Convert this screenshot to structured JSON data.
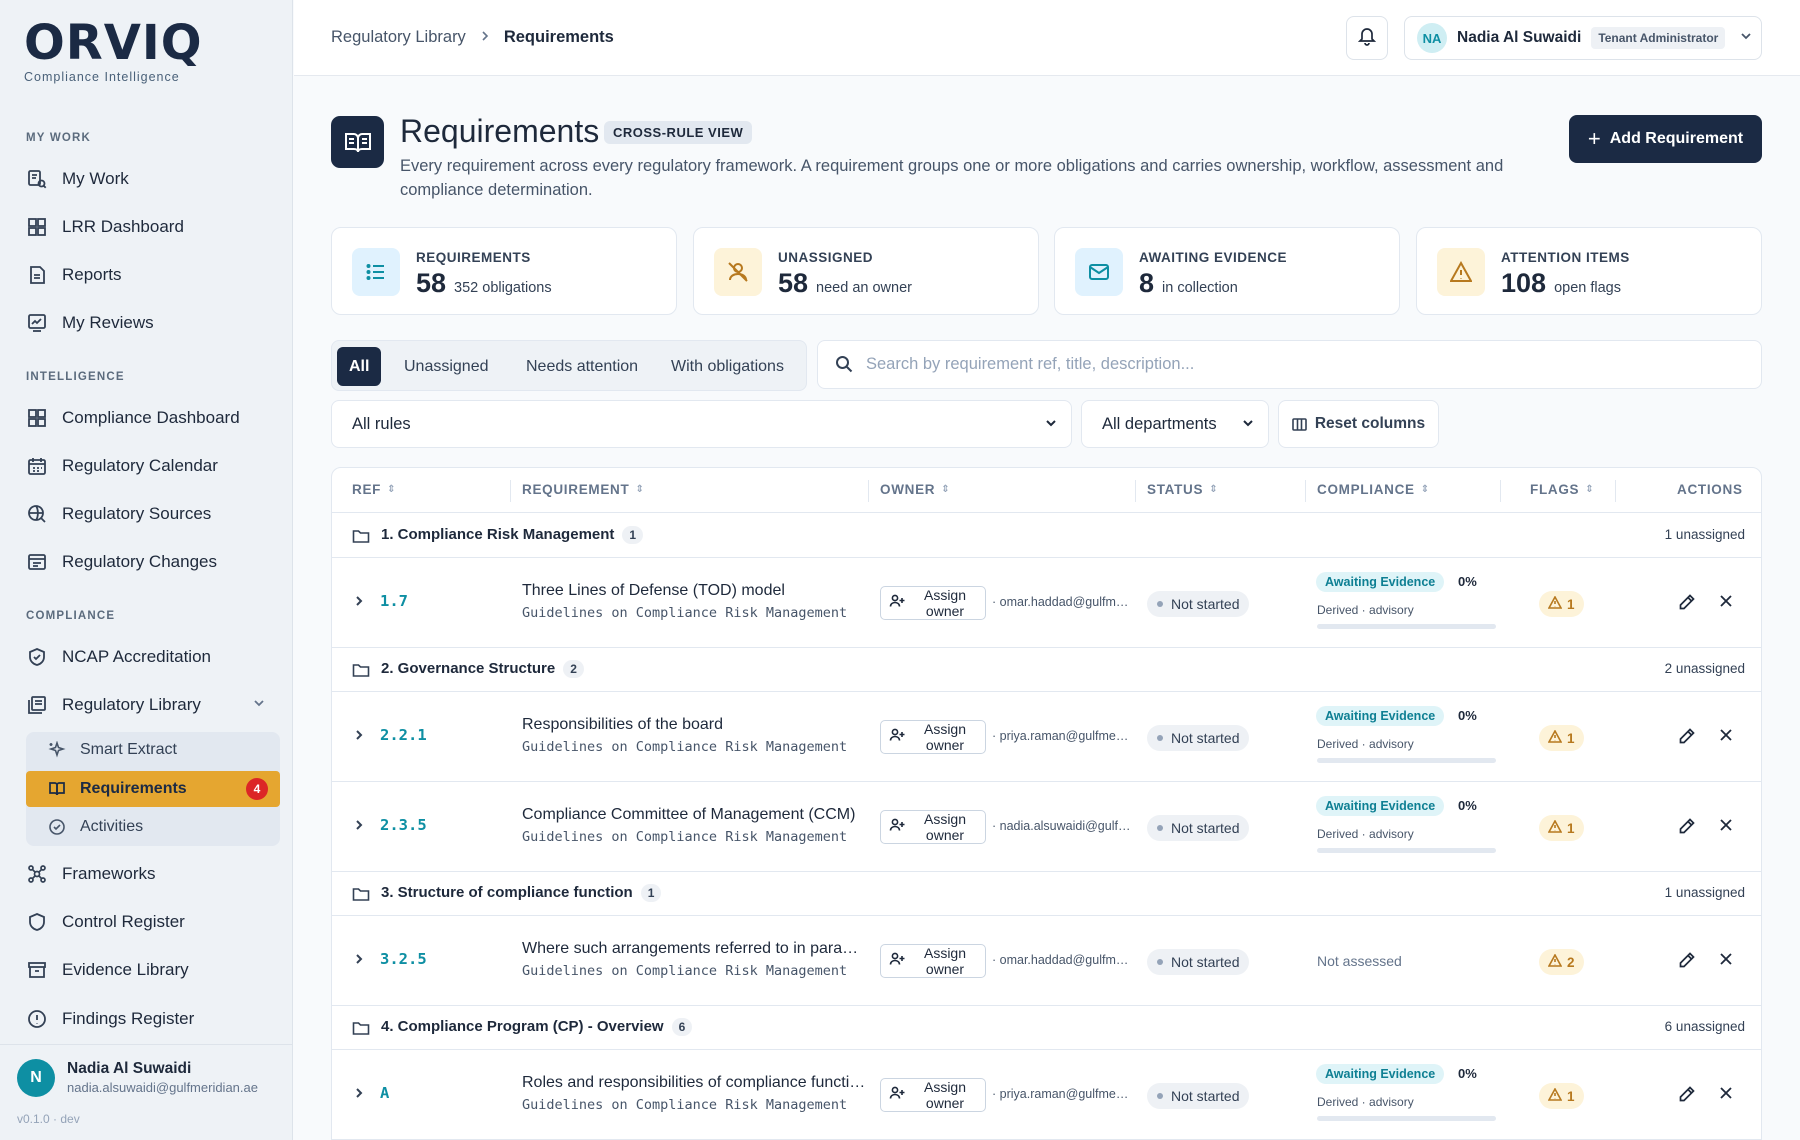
{
  "brand": {
    "name": "ORVIQ",
    "tagline": "Compliance Intelligence"
  },
  "sidebar": {
    "sections": [
      {
        "label": "MY WORK"
      },
      {
        "label": "INTELLIGENCE"
      },
      {
        "label": "COMPLIANCE"
      }
    ],
    "items": [
      {
        "label": "My Work",
        "icon": "my-work-icon"
      },
      {
        "label": "LRR Dashboard",
        "icon": "dashboard-icon"
      },
      {
        "label": "Reports",
        "icon": "reports-icon"
      },
      {
        "label": "My Reviews",
        "icon": "reviews-icon"
      },
      {
        "label": "Compliance Dashboard",
        "icon": "dashboard-icon"
      },
      {
        "label": "Regulatory Calendar",
        "icon": "calendar-icon"
      },
      {
        "label": "Regulatory Sources",
        "icon": "sources-icon"
      },
      {
        "label": "Regulatory Changes",
        "icon": "changes-icon"
      },
      {
        "label": "NCAP Accreditation",
        "icon": "shield-check-icon"
      },
      {
        "label": "Regulatory Library",
        "icon": "library-icon"
      },
      {
        "label": "Frameworks",
        "icon": "frameworks-icon"
      },
      {
        "label": "Control Register",
        "icon": "shield-icon"
      },
      {
        "label": "Evidence Library",
        "icon": "archive-icon"
      },
      {
        "label": "Findings Register",
        "icon": "alert-circle-icon"
      }
    ],
    "subitems": [
      {
        "label": "Smart Extract",
        "icon": "sparkles-icon"
      },
      {
        "label": "Requirements",
        "icon": "book-icon",
        "count": "4"
      },
      {
        "label": "Activities",
        "icon": "check-circle-icon"
      }
    ],
    "user": {
      "initial": "N",
      "name": "Nadia Al Suwaidi",
      "email": "nadia.alsuwaidi@gulfmeridian.ae"
    },
    "version": "v0.1.0 · dev"
  },
  "topbar": {
    "breadcrumb": [
      "Regulatory Library",
      "Requirements"
    ],
    "user": {
      "initials": "NA",
      "name": "Nadia Al Suwaidi",
      "role": "Tenant Administrator"
    }
  },
  "header": {
    "title": "Requirements",
    "badge": "CROSS-RULE VIEW",
    "description": "Every requirement across every regulatory framework. A requirement groups one or more obligations and carries ownership, workflow, assessment and compliance determination.",
    "add_label": "Add Requirement"
  },
  "stats": [
    {
      "label": "REQUIREMENTS",
      "value": "58",
      "sub": "352 obligations",
      "icon": "list-icon",
      "bg": "#e0f2fe",
      "fg": "#0e8fa3"
    },
    {
      "label": "UNASSIGNED",
      "value": "58",
      "sub": "need an owner",
      "icon": "user-off-icon",
      "bg": "#fdf3d9",
      "fg": "#b7791f"
    },
    {
      "label": "AWAITING EVIDENCE",
      "value": "8",
      "sub": "in collection",
      "icon": "mail-icon",
      "bg": "#e0f2fe",
      "fg": "#0e8fa3"
    },
    {
      "label": "ATTENTION ITEMS",
      "value": "108",
      "sub": "open flags",
      "icon": "warning-icon",
      "bg": "#fdf3d9",
      "fg": "#b7791f"
    }
  ],
  "filters": {
    "tabs": [
      "All",
      "Unassigned",
      "Needs attention",
      "With obligations"
    ],
    "search_placeholder": "Search by requirement ref, title, description...",
    "rules_value": "All rules",
    "departments_value": "All departments",
    "reset_label": "Reset columns"
  },
  "table": {
    "columns": [
      "REF",
      "REQUIREMENT",
      "OWNER",
      "STATUS",
      "COMPLIANCE",
      "FLAGS",
      "ACTIONS"
    ],
    "groups": [
      {
        "name": "1. Compliance Risk Management",
        "count": "1",
        "unassigned": "1 unassigned"
      },
      {
        "name": "2. Governance Structure",
        "count": "2",
        "unassigned": "2 unassigned"
      },
      {
        "name": "3. Structure of compliance function",
        "count": "1",
        "unassigned": "1 unassigned"
      },
      {
        "name": "4. Compliance Program (CP) - Overview",
        "count": "6",
        "unassigned": "6 unassigned"
      }
    ],
    "rows": [
      {
        "ref": "1.7",
        "title": "Three Lines of Defense (TOD) model",
        "source": "Guidelines on Compliance Risk Management",
        "assign": "Assign owner",
        "email": "· omar.haddad@gulfmeridian.ae",
        "status": "Not started",
        "compliance": "Awaiting Evidence",
        "pct": "0%",
        "pct_value": 0,
        "derived": "Derived · advisory",
        "flags": "1"
      },
      {
        "ref": "2.2.1",
        "title": "Responsibilities of the board",
        "source": "Guidelines on Compliance Risk Management",
        "assign": "Assign owner",
        "email": "· priya.raman@gulfmeridian.ae",
        "status": "Not started",
        "compliance": "Awaiting Evidence",
        "pct": "0%",
        "pct_value": 0,
        "derived": "Derived · advisory",
        "flags": "1"
      },
      {
        "ref": "2.3.5",
        "title": "Compliance Committee of Management (CCM)",
        "source": "Guidelines on Compliance Risk Management",
        "assign": "Assign owner",
        "email": "· nadia.alsuwaidi@gulfmeridian.ae",
        "status": "Not started",
        "compliance": "Awaiting Evidence",
        "pct": "0%",
        "pct_value": 0,
        "derived": "Derived · advisory",
        "flags": "1"
      },
      {
        "ref": "3.2.5",
        "title": "Where such arrangements referred to in paragraph",
        "source": "Guidelines on Compliance Risk Management",
        "assign": "Assign owner",
        "email": "· omar.haddad@gulfmeridian.ae",
        "status": "Not started",
        "compliance_na": "Not assessed",
        "flags": "2"
      },
      {
        "ref": "A",
        "title": "Roles and responsibilities of compliance function",
        "source": "Guidelines on Compliance Risk Management",
        "assign": "Assign owner",
        "email": "· priya.raman@gulfmeridian.ae",
        "status": "Not started",
        "compliance": "Awaiting Evidence",
        "pct": "0%",
        "pct_value": 0,
        "derived": "Derived · advisory",
        "flags": "1"
      }
    ]
  }
}
